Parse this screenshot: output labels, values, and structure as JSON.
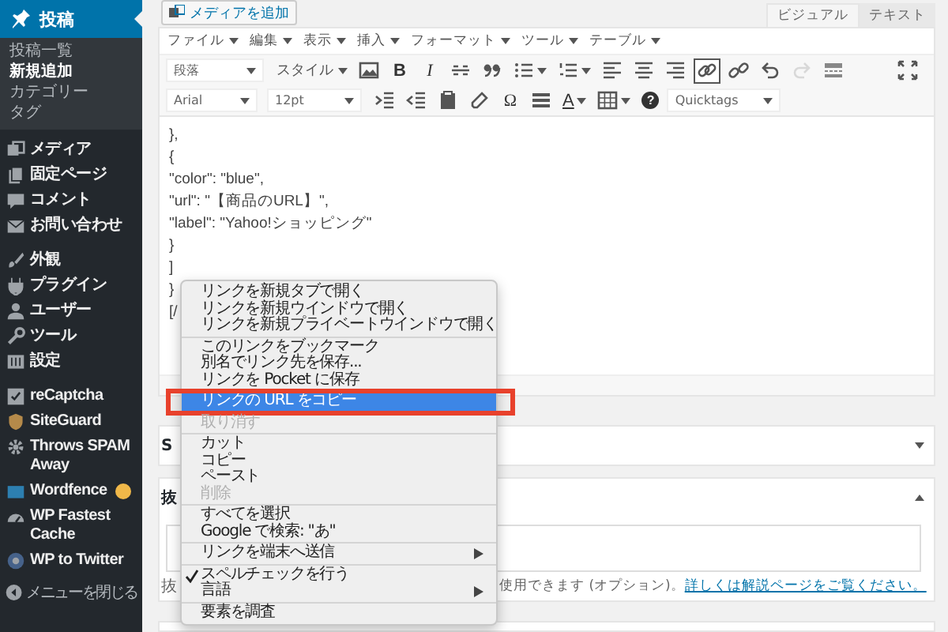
{
  "sidebar": {
    "current": {
      "label": "投稿",
      "selected": true
    },
    "submenu": [
      {
        "label": "投稿一覧",
        "selected": false
      },
      {
        "label": "新規追加",
        "selected": true
      },
      {
        "label": "カテゴリー",
        "selected": false
      },
      {
        "label": "タグ",
        "selected": false
      }
    ],
    "groups": [
      [
        {
          "label": "メディア",
          "badge": false
        },
        {
          "label": "固定ページ",
          "badge": false
        },
        {
          "label": "コメント",
          "badge": false
        },
        {
          "label": "お問い合わせ",
          "badge": false
        }
      ],
      [
        {
          "label": "外観",
          "badge": false
        },
        {
          "label": "プラグイン",
          "badge": false
        },
        {
          "label": "ユーザー",
          "badge": false
        },
        {
          "label": "ツール",
          "badge": false
        },
        {
          "label": "設定",
          "badge": false
        }
      ],
      [
        {
          "label": "reCaptcha",
          "badge": false
        },
        {
          "label": "SiteGuard",
          "badge": false
        },
        {
          "label": "Throws SPAM Away",
          "badge": false
        },
        {
          "label": "Wordfence",
          "badge": true
        },
        {
          "label": "WP Fastest Cache",
          "badge": false
        },
        {
          "label": "WP to Twitter",
          "badge": false
        }
      ]
    ],
    "collapse": "メニューを閉じる"
  },
  "editor": {
    "add_media": "メディアを追加",
    "tabs": [
      {
        "label": "ビジュアル",
        "selected": true
      },
      {
        "label": "テキスト",
        "selected": false
      }
    ],
    "menubar": [
      "ファイル",
      "編集",
      "表示",
      "挿入",
      "フォーマット",
      "ツール",
      "テーブル"
    ],
    "toolbar_1": [
      {
        "kind": "select",
        "label": "段落"
      },
      {
        "kind": "menu",
        "label": "スタイル"
      },
      {
        "kind": "image",
        "active": false,
        "disabled": false
      },
      {
        "kind": "glyph",
        "label": "B",
        "active": false,
        "disabled": false
      },
      {
        "kind": "italic",
        "label": "I",
        "active": false,
        "disabled": false
      },
      {
        "kind": "strike",
        "active": false,
        "disabled": false
      },
      {
        "kind": "quote",
        "active": false,
        "disabled": false
      },
      {
        "kind": "bullets",
        "active": false,
        "disabled": false
      },
      {
        "kind": "numbers",
        "active": false,
        "disabled": false
      },
      {
        "kind": "align-left",
        "active": false,
        "disabled": false
      },
      {
        "kind": "align-center",
        "active": false,
        "disabled": false
      },
      {
        "kind": "align-right",
        "active": false,
        "disabled": false
      },
      {
        "kind": "link",
        "active": true,
        "disabled": false
      },
      {
        "kind": "unlink",
        "active": false,
        "disabled": false
      },
      {
        "kind": "undo",
        "active": false,
        "disabled": false
      },
      {
        "kind": "redo",
        "active": false,
        "disabled": true
      },
      {
        "kind": "more",
        "active": false,
        "disabled": false
      },
      {
        "kind": "fullscreen",
        "active": false,
        "disabled": false
      }
    ],
    "toolbar_2": [
      {
        "kind": "select",
        "label": "Arial"
      },
      {
        "kind": "select",
        "label": "12pt"
      },
      {
        "kind": "indent",
        "active": false,
        "disabled": false
      },
      {
        "kind": "outdent",
        "active": false,
        "disabled": false
      },
      {
        "kind": "paste",
        "active": false,
        "disabled": false
      },
      {
        "kind": "eraser",
        "active": false,
        "disabled": false
      },
      {
        "kind": "glyph",
        "label": "Ω",
        "active": false,
        "disabled": false
      },
      {
        "kind": "hr",
        "active": false,
        "disabled": false
      },
      {
        "kind": "color",
        "label": "A",
        "active": false,
        "disabled": false
      },
      {
        "kind": "table",
        "active": false,
        "disabled": false
      },
      {
        "kind": "help",
        "label": "?",
        "active": false,
        "disabled": false
      },
      {
        "kind": "select",
        "label": "Quicktags"
      }
    ],
    "content": [
      "},",
      "{",
      "\"color\": \"blue\",",
      "\"url\": \"【商品のURL】\",",
      "\"label\": \"Yahoo!ショッピング\"",
      "}",
      "]",
      "}",
      "[/"
    ]
  },
  "boxes": [
    {
      "heading": "S",
      "expanded": false
    },
    {
      "heading": "抜",
      "expanded": true,
      "help_start": "抜",
      "help_text": "使用できます (オプション)。",
      "help_link": "詳しくは解説ページをご覧ください。"
    }
  ],
  "context_menu": [
    [
      {
        "label": "リンクを新規タブで開く",
        "selected": false,
        "disabled": false,
        "checked": false,
        "submenu": false
      },
      {
        "label": "リンクを新規ウインドウで開く",
        "selected": false,
        "disabled": false,
        "checked": false,
        "submenu": false
      },
      {
        "label": "リンクを新規プライベートウインドウで開く",
        "selected": false,
        "disabled": false,
        "checked": false,
        "submenu": false
      }
    ],
    [
      {
        "label": "このリンクをブックマーク",
        "selected": false,
        "disabled": false,
        "checked": false,
        "submenu": false
      },
      {
        "label": "別名でリンク先を保存...",
        "selected": false,
        "disabled": false,
        "checked": false,
        "submenu": false
      },
      {
        "label": "リンクを Pocket に保存",
        "selected": false,
        "disabled": false,
        "checked": false,
        "submenu": false
      },
      {
        "label": "リンクの URL をコピー",
        "selected": true,
        "disabled": false,
        "checked": false,
        "submenu": false
      },
      {
        "label": "取り消す",
        "selected": false,
        "disabled": true,
        "checked": false,
        "submenu": false
      }
    ],
    [
      {
        "label": "カット",
        "selected": false,
        "disabled": false,
        "checked": false,
        "submenu": false
      },
      {
        "label": "コピー",
        "selected": false,
        "disabled": false,
        "checked": false,
        "submenu": false
      },
      {
        "label": "ペースト",
        "selected": false,
        "disabled": false,
        "checked": false,
        "submenu": false
      },
      {
        "label": "削除",
        "selected": false,
        "disabled": true,
        "checked": false,
        "submenu": false
      }
    ],
    [
      {
        "label": "すべてを選択",
        "selected": false,
        "disabled": false,
        "checked": false,
        "submenu": false
      },
      {
        "label": "Google で検索: \"あ\"",
        "selected": false,
        "disabled": false,
        "checked": false,
        "submenu": false
      }
    ],
    [
      {
        "label": "リンクを端末へ送信",
        "selected": false,
        "disabled": false,
        "checked": false,
        "submenu": true
      }
    ],
    [
      {
        "label": "スペルチェックを行う",
        "selected": false,
        "disabled": false,
        "checked": true,
        "submenu": false
      },
      {
        "label": "言語",
        "selected": false,
        "disabled": false,
        "checked": false,
        "submenu": true
      }
    ],
    [
      {
        "label": "要素を調査",
        "selected": false,
        "disabled": false,
        "checked": false,
        "submenu": false
      }
    ]
  ]
}
